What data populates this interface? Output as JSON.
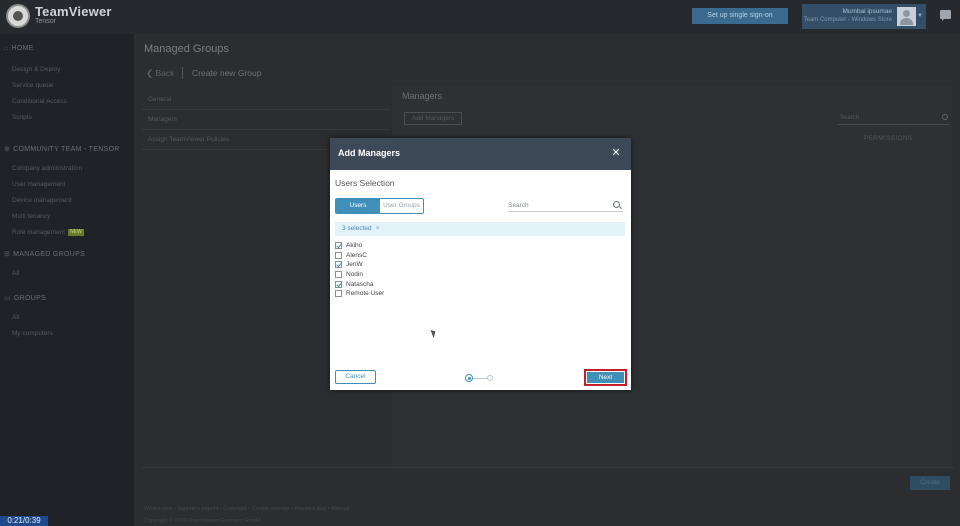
{
  "topbar": {
    "brand": "TeamViewer",
    "brand_sub": "Tensor",
    "setup_button": "Set up single sign-on",
    "user_name": "Mumbai ipsumae",
    "user_company": "Team Computer - Windows Store"
  },
  "sidebar": {
    "home": {
      "label": "HOME",
      "icon": "home-icon",
      "items": [
        "Design & Deploy",
        "Service queue",
        "Conditional Access",
        "Scripts"
      ]
    },
    "community": {
      "label": "COMMUNITY TEAM - TENSOR",
      "icon": "team-icon",
      "items": [
        "Company administration",
        "User management",
        "Device management",
        "Multi tenancy"
      ],
      "role_mgmt": "Role management",
      "role_mgmt_badge": "NEW"
    },
    "managed_groups": {
      "label": "MANAGED GROUPS",
      "icon": "managed-groups-icon",
      "items": [
        "All"
      ]
    },
    "groups": {
      "label": "GROUPS",
      "icon": "groups-icon",
      "items": [
        "All",
        "My computers"
      ]
    }
  },
  "main": {
    "page_title": "Managed Groups",
    "back_label": "Back",
    "crumb_title": "Create new Group",
    "left_tabs": [
      "General",
      "Managers",
      "Assign TeamViewer Policies"
    ],
    "managers_header": "Managers",
    "add_managers_label": "Add Managers",
    "search_placeholder": "Search",
    "permissions_header": "PERMISSIONS",
    "save_label": "Create",
    "footer_links": "What's new • Support • Imprint • Copyright • Cookie settings • Report a bug • Manual",
    "footer_copy": "Copyright © 2020 TeamViewer Germany GmbH"
  },
  "timestamp": "0:21/0:39",
  "modal": {
    "title": "Add Managers",
    "close_icon": "close-icon",
    "section_title": "Users Selection",
    "toggle_users": "Users",
    "toggle_user_groups": "User Groups",
    "search_placeholder": "Search",
    "selected_chip": "3 selected",
    "chip_clear": "×",
    "users": [
      {
        "name": "Akiho",
        "checked": true
      },
      {
        "name": "AlensC",
        "checked": false
      },
      {
        "name": "JenW",
        "checked": true
      },
      {
        "name": "Nodin",
        "checked": false
      },
      {
        "name": "Natascha",
        "checked": true
      },
      {
        "name": "Remote User",
        "checked": false
      }
    ],
    "cancel_label": "Cancel",
    "next_label": "Next",
    "step_current": 1,
    "step_total": 2
  },
  "colors": {
    "accent": "#3f8fb8",
    "modal_header": "#3e4957",
    "highlight_border": "#c0202a",
    "topbar": "#262a2f",
    "sidebar": "#1f2226"
  }
}
